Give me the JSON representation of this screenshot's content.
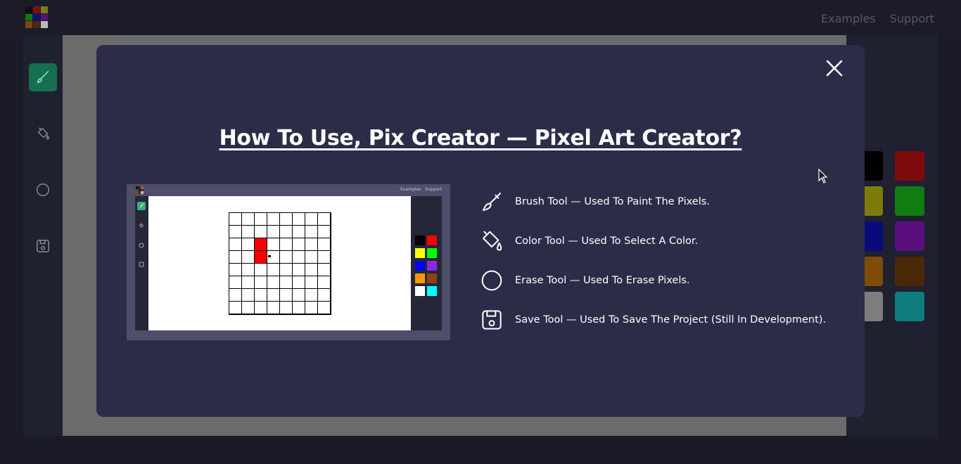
{
  "nav": {
    "examples": "Examples",
    "support": "Support"
  },
  "logo_colors": [
    "#111111",
    "#7a1010",
    "#7a7a10",
    "#127a12",
    "#10107a",
    "#5a127a",
    "#7a4a10",
    "#4a2a10",
    "#bbbbbb"
  ],
  "tools": [
    {
      "name": "brush-icon",
      "active": true
    },
    {
      "name": "fill-bucket-icon",
      "active": false
    },
    {
      "name": "eraser-circle-icon",
      "active": false
    },
    {
      "name": "save-icon",
      "active": false
    }
  ],
  "palette": [
    "#000000",
    "#7d0b0b",
    "#7c7c0a",
    "#117c11",
    "#0a0a7d",
    "#5a0f7d",
    "#7e4c08",
    "#4a2808",
    "#7d7d7d",
    "#0f7d7d"
  ],
  "modal": {
    "title": "How To Use, Pix Creator — Pixel Art Creator?",
    "preview": {
      "nav_examples": "Examples",
      "nav_support": "Support",
      "palette": [
        "#000000",
        "#ff0000",
        "#ffff00",
        "#00ff00",
        "#0000ff",
        "#8a2be2",
        "#ff9900",
        "#8b4513",
        "#ffffff",
        "#00ffff"
      ],
      "painted_color": "#ff0000"
    },
    "items": [
      {
        "icon": "brush-icon",
        "text": "Brush Tool — Used To Paint The Pixels."
      },
      {
        "icon": "fill-bucket-icon",
        "text": "Color Tool — Used To Select A Color."
      },
      {
        "icon": "eraser-circle-icon",
        "text": "Erase Tool — Used To Erase Pixels."
      },
      {
        "icon": "save-icon",
        "text": "Save Tool — Used To Save The Project (Still In Development)."
      }
    ]
  },
  "colors": {
    "accent": "#16704f",
    "modal_bg": "#2b2c48",
    "page_bg": "#1a1b26"
  }
}
